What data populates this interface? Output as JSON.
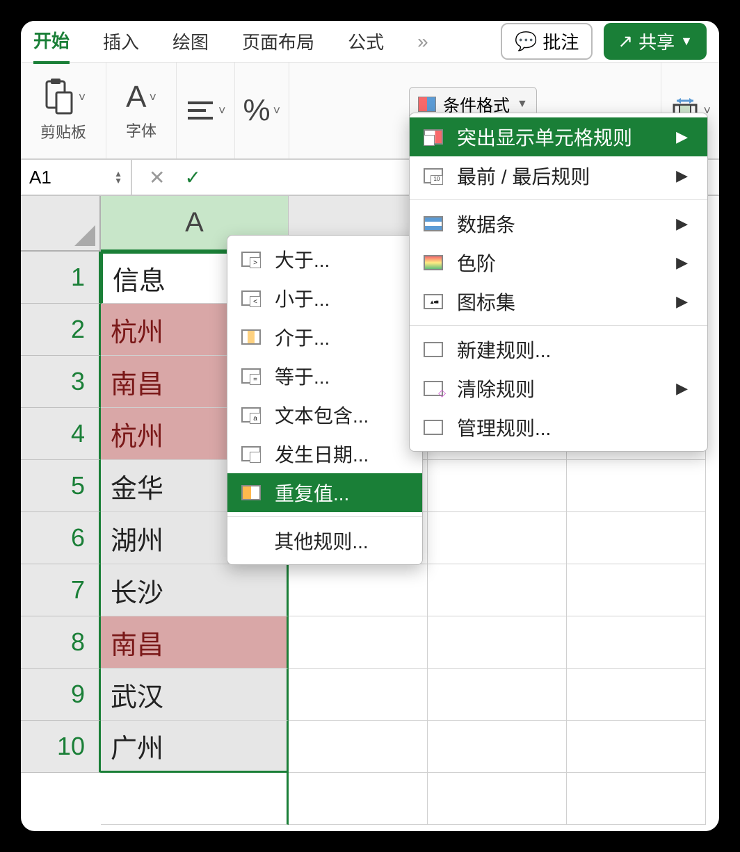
{
  "tabs": {
    "t0": "开始",
    "t1": "插入",
    "t2": "绘图",
    "t3": "页面布局",
    "t4": "公式"
  },
  "buttons": {
    "comment": "批注",
    "share": "共享"
  },
  "groups": {
    "clipboard": "剪贴板",
    "font": "字体",
    "condfmt": "条件格式"
  },
  "name_box": "A1",
  "col_A": "A",
  "rows": [
    "1",
    "2",
    "3",
    "4",
    "5",
    "6",
    "7",
    "8",
    "9",
    "10"
  ],
  "cells_A": [
    "信息",
    "杭州",
    "南昌",
    "杭州",
    "金华",
    "湖州",
    "长沙",
    "南昌",
    "武汉",
    "广州"
  ],
  "menu1": {
    "gt": "大于...",
    "lt": "小于...",
    "between": "介于...",
    "eq": "等于...",
    "text": "文本包含...",
    "date": "发生日期...",
    "dup": "重复值...",
    "other": "其他规则..."
  },
  "menu2": {
    "highlight": "突出显示单元格规则",
    "toplast": "最前 / 最后规则",
    "databars": "数据条",
    "colorscale": "色阶",
    "iconset": "图标集",
    "new": "新建规则...",
    "clear": "清除规则",
    "manage": "管理规则..."
  }
}
